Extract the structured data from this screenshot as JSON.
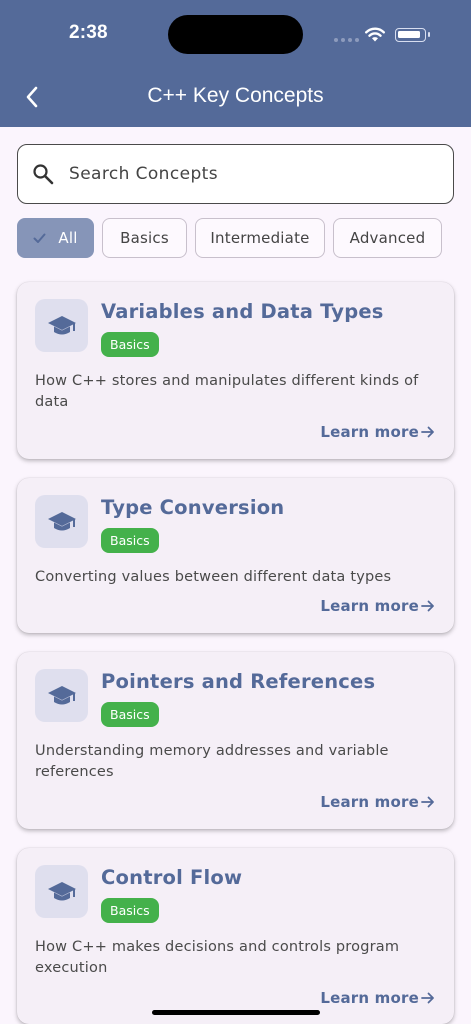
{
  "status_bar": {
    "time": "2:38"
  },
  "header": {
    "title": "C++ Key Concepts",
    "back_icon": "chevron-left-icon"
  },
  "search": {
    "placeholder": "Search Concepts",
    "icon": "search-icon"
  },
  "filters": [
    {
      "label": "All",
      "selected": true
    },
    {
      "label": "Basics",
      "selected": false
    },
    {
      "label": "Intermediate",
      "selected": false
    },
    {
      "label": "Advanced",
      "selected": false
    }
  ],
  "concepts": [
    {
      "title": "Variables and Data Types",
      "level": "Basics",
      "description": "How C++ stores and manipulates different kinds of data",
      "action": "Learn more"
    },
    {
      "title": "Type Conversion",
      "level": "Basics",
      "description": "Converting values between different data types",
      "action": "Learn more"
    },
    {
      "title": "Pointers and References",
      "level": "Basics",
      "description": "Understanding memory addresses and variable references",
      "action": "Learn more"
    },
    {
      "title": "Control Flow",
      "level": "Basics",
      "description": "How C++ makes decisions and controls program execution",
      "action": "Learn more"
    }
  ],
  "colors": {
    "header": "#546a99",
    "accent": "#546a99",
    "badge": "#44b14b",
    "chip_selected": "#8695b8",
    "card": "#f5eff7",
    "background": "#fbf5fd"
  },
  "icons": {
    "concept_icon": "graduation-cap-icon",
    "arrow": "arrow-right-icon",
    "check": "check-icon"
  }
}
